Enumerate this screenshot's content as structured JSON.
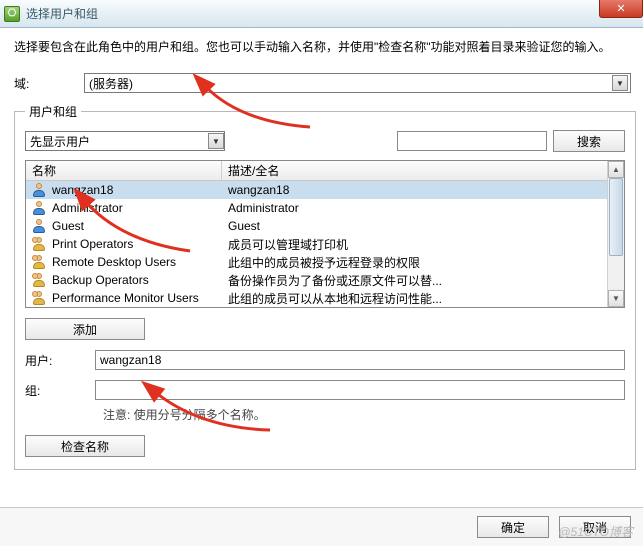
{
  "window": {
    "title": "选择用户和组",
    "instruction": "选择要包含在此角色中的用户和组。您也可以手动输入名称，并使用\"检查名称\"功能对照着目录来验证您的输入。"
  },
  "domain": {
    "label": "域:",
    "value": "(服务器)"
  },
  "group": {
    "legend": "用户和组",
    "show_first": "先显示用户",
    "search_btn": "搜索",
    "columns": {
      "name": "名称",
      "desc": "描述/全名"
    },
    "rows": [
      {
        "type": "user",
        "name": "wangzan18",
        "desc": "wangzan18",
        "selected": true
      },
      {
        "type": "user",
        "name": "Administrator",
        "desc": "Administrator",
        "selected": false
      },
      {
        "type": "user",
        "name": "Guest",
        "desc": "Guest",
        "selected": false
      },
      {
        "type": "group",
        "name": "Print Operators",
        "desc": "成员可以管理域打印机",
        "selected": false
      },
      {
        "type": "group",
        "name": "Remote Desktop Users",
        "desc": "此组中的成员被授予远程登录的权限",
        "selected": false
      },
      {
        "type": "group",
        "name": "Backup Operators",
        "desc": "备份操作员为了备份或还原文件可以替...",
        "selected": false
      },
      {
        "type": "group",
        "name": "Performance Monitor Users",
        "desc": "此组的成员可以从本地和远程访问性能...",
        "selected": false
      }
    ],
    "add_btn": "添加"
  },
  "fields": {
    "user_label": "用户:",
    "user_value": "wangzan18",
    "group_label": "组:",
    "group_value": "",
    "hint": "注意: 使用分号分隔多个名称。",
    "check_btn": "检查名称"
  },
  "footer": {
    "ok": "确定",
    "cancel": "取消"
  },
  "watermark": "@51CTO博客"
}
